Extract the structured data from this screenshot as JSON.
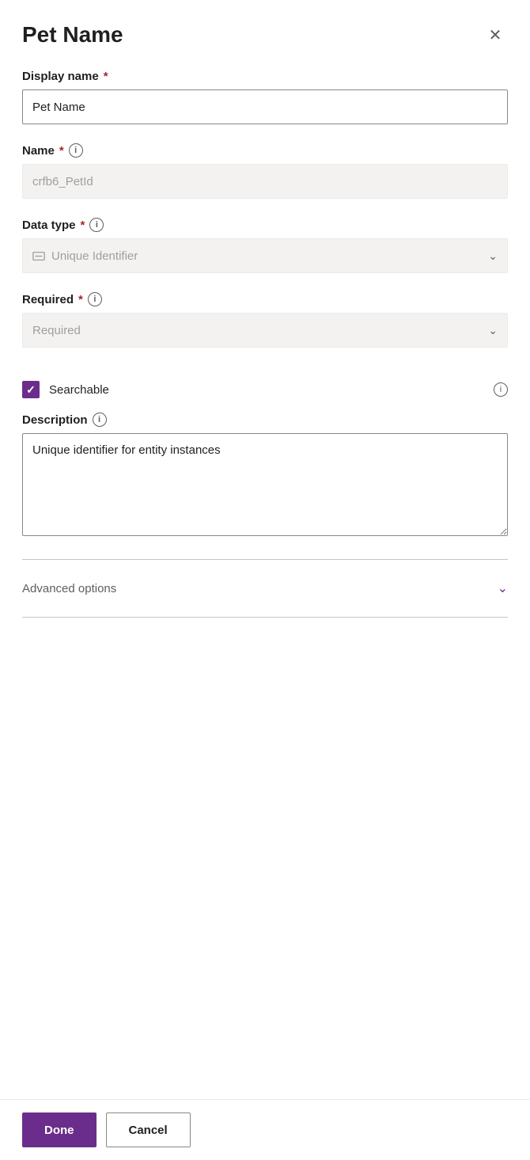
{
  "panel": {
    "title": "Pet Name",
    "close_label": "×"
  },
  "display_name": {
    "label": "Display name",
    "required": true,
    "value": "Pet Name",
    "placeholder": "Pet Name"
  },
  "name_field": {
    "label": "Name",
    "required": true,
    "value": "crfb6_PetId",
    "placeholder": "crfb6_PetId"
  },
  "data_type": {
    "label": "Data type",
    "required": true,
    "value": "Unique Identifier",
    "placeholder": "Unique Identifier"
  },
  "required_field": {
    "label": "Required",
    "required": true,
    "value": "Required",
    "placeholder": "Required"
  },
  "searchable": {
    "label": "Searchable",
    "checked": true
  },
  "description": {
    "label": "Description",
    "value": "Unique identifier for entity instances",
    "placeholder": ""
  },
  "advanced_options": {
    "label": "Advanced options"
  },
  "footer": {
    "done_label": "Done",
    "cancel_label": "Cancel"
  },
  "icons": {
    "info": "i",
    "chevron_down": "∨",
    "close": "✕",
    "check": "✓"
  }
}
